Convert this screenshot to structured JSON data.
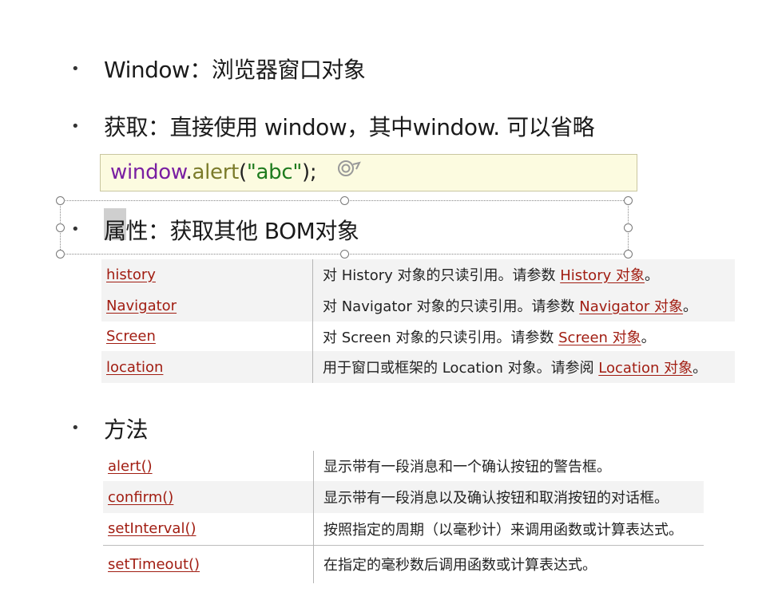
{
  "bullets": {
    "window_title": "Window：浏览器窗口对象",
    "get": "获取：直接使用 window，其中window. 可以省略",
    "props_prefix": "属",
    "props_rest": "性：获取其他 BOM对象",
    "methods": "方法"
  },
  "code": {
    "obj": "window",
    "dot": ".",
    "method": "alert",
    "open": "(",
    "arg": "\"abc\"",
    "close": ");"
  },
  "properties": [
    {
      "name": "history",
      "desc_pre": "对 History 对象的只读引用。请参数 ",
      "link": "History 对象",
      "desc_post": "。"
    },
    {
      "name": "Navigator",
      "desc_pre": "对 Navigator 对象的只读引用。请参数 ",
      "link": "Navigator 对象",
      "desc_post": "。"
    },
    {
      "name": "Screen",
      "desc_pre": "对 Screen 对象的只读引用。请参数 ",
      "link": "Screen 对象",
      "desc_post": "。"
    },
    {
      "name": "location",
      "desc_pre": "用于窗口或框架的 Location 对象。请参阅 ",
      "link": "Location 对象",
      "desc_post": "。"
    }
  ],
  "methods": [
    {
      "name": "alert()",
      "desc": "显示带有一段消息和一个确认按钮的警告框。"
    },
    {
      "name": "confirm()",
      "desc": "显示带有一段消息以及确认按钮和取消按钮的对话框。"
    },
    {
      "name": "setInterval()",
      "desc": "按照指定的周期（以毫秒计）来调用函数或计算表达式。"
    },
    {
      "name": "setTimeout()",
      "desc": "在指定的毫秒数后调用函数或计算表达式。"
    }
  ],
  "colors": {
    "link": "#a11d12",
    "code_obj": "#7a1fa2",
    "code_method": "#7b7b2a",
    "code_string": "#1e7b1e",
    "code_bg": "#fcfbe0"
  },
  "icons": [
    "bullet-dot",
    "refresh-icon",
    "selection-handle"
  ]
}
